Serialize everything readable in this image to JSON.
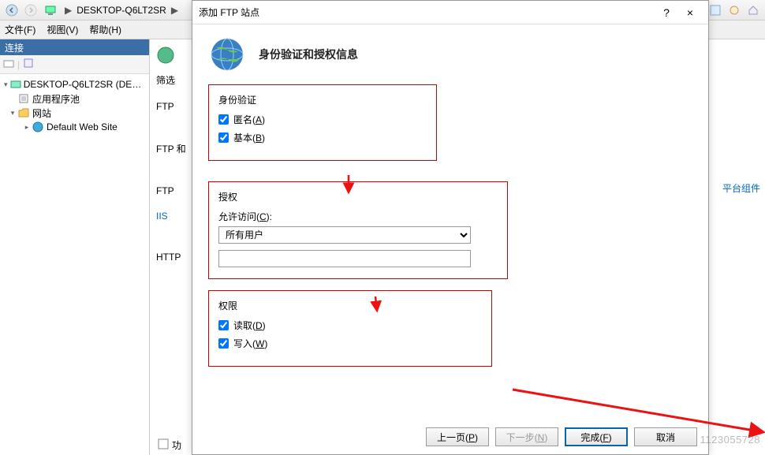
{
  "toolbar": {
    "breadcrumb_root": "DESKTOP-Q6LT2SR",
    "breadcrumb_sep": "▶"
  },
  "menu": {
    "file": "文件(F)",
    "view": "视图(V)",
    "help": "帮助(H)"
  },
  "conn": {
    "header": "连接",
    "root": "DESKTOP-Q6LT2SR (DESKTOP",
    "app_pool": "应用程序池",
    "sites": "网站",
    "default_site": "Default Web Site"
  },
  "main": {
    "filter": "筛选",
    "ftp": "FTP",
    "ftp2": "FTP 和",
    "ftp3": "FTP",
    "iis": "IIS",
    "http": "HTTP",
    "right_link": "平台组件",
    "bottom": "功"
  },
  "dialog": {
    "title": "添加 FTP 站点",
    "help": "?",
    "close": "×",
    "heading": "身份验证和授权信息",
    "auth": {
      "legend": "身份验证",
      "anonymous": "匿名(A)",
      "basic": "基本(B)"
    },
    "authz": {
      "legend": "授权",
      "allow_label": "允许访问(C):",
      "allow_value": "所有用户"
    },
    "perm": {
      "legend": "权限",
      "read": "读取(D)",
      "write": "写入(W)"
    },
    "buttons": {
      "prev": "上一页(P)",
      "next": "下一步(N)",
      "finish": "完成(F)",
      "cancel": "取消"
    }
  },
  "watermark": "1123055728"
}
